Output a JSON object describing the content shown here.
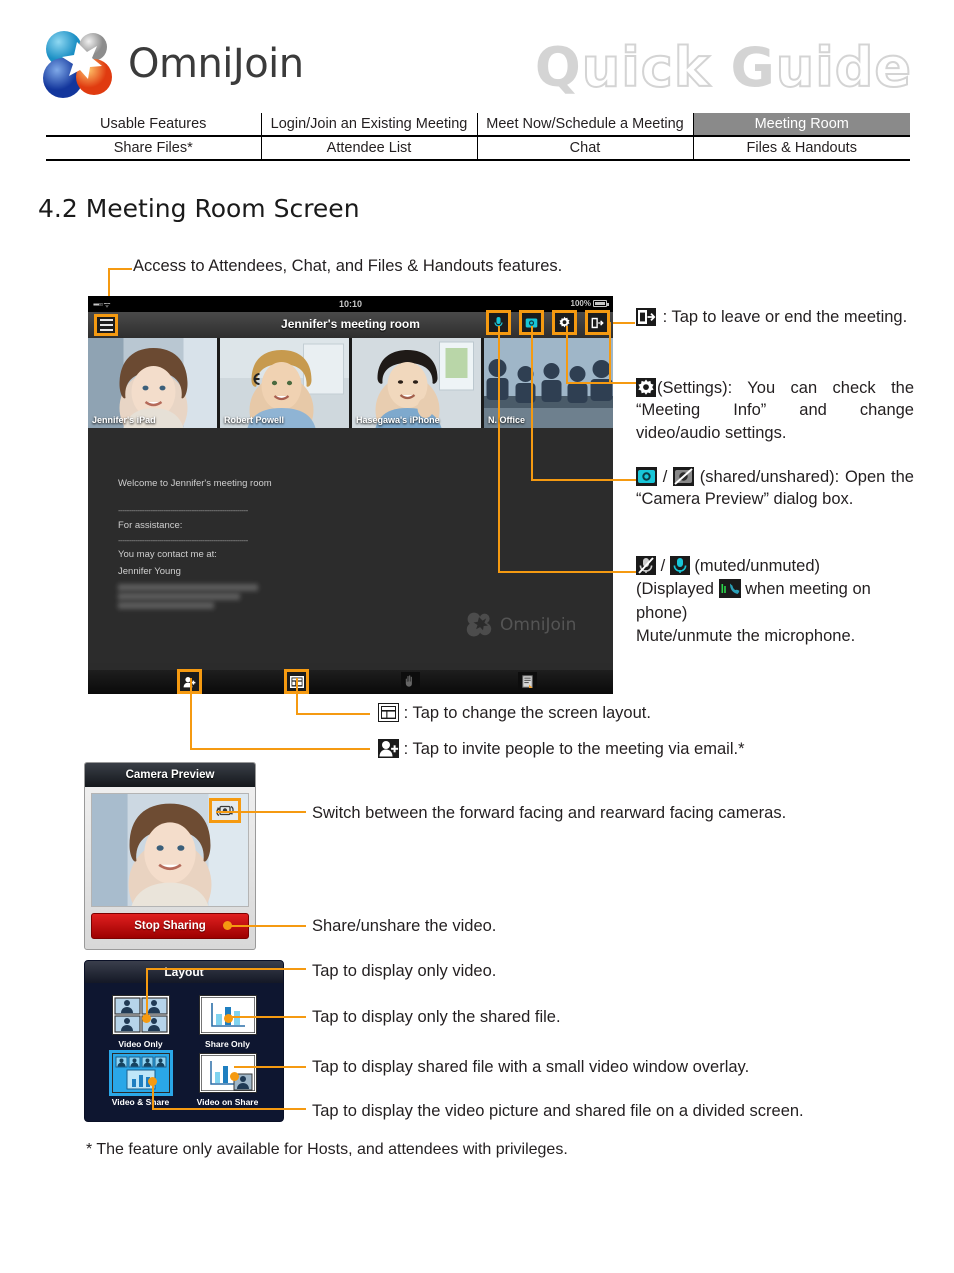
{
  "header": {
    "brand": "OmniJoin",
    "guide_solid_1": "Q",
    "guide_outline_1": "uick",
    "guide_solid_2": "G",
    "guide_outline_2": "uide",
    "accent_color": "#f59a11",
    "active_nav_bg": "#8a8a8a"
  },
  "nav": {
    "row1": [
      "Usable Features",
      "Login/Join an Existing Meeting",
      "Meet Now/Schedule a Meeting",
      "Meeting Room"
    ],
    "row2": [
      "Share Files*",
      "Attendee List",
      "Chat",
      "Files & Handouts"
    ],
    "active": "Meeting Room"
  },
  "section": {
    "title": "4.2 Meeting Room Screen"
  },
  "callouts": {
    "menu": "Access to Attendees, Chat, and Files & Handouts features.",
    "leave_icon": "leave-meeting-icon",
    "leave": " : Tap to leave or end the meeting.",
    "settings_icon": "gear-icon",
    "settings": "(Settings): You can check the “Meeting Info” and change video/audio settings.",
    "camera_shared_icon": "camera-shared-icon",
    "camera_unshared_icon": "camera-unshared-icon",
    "camera_slash": " / ",
    "camera": " (shared/unshared): Open the “Camera Preview” dialog box.",
    "mic_muted_icon": "mic-muted-icon",
    "mic_unmuted_icon": "mic-unmuted-icon",
    "phone_icon": "phone-meeting-icon",
    "mic_line1_a": " / ",
    "mic_line1_b": " (muted/unmuted)",
    "mic_line2_a": "(Displayed ",
    "mic_line2_b": " when meeting on phone)",
    "mic_line3": "Mute/unmute the microphone.",
    "layout_icon": "layout-icon",
    "layout": " : Tap to change the screen layout.",
    "invite_icon": "invite-person-icon",
    "invite": " : Tap to invite people to the meeting via email.*",
    "switch_camera": "Switch between the forward facing and rearward facing cameras.",
    "share_video": "Share/unshare the video.",
    "video_only": "Tap to display only video.",
    "share_only": "Tap to display only the shared file.",
    "video_on_share": "Tap to display shared file with a small video window overlay.",
    "video_and_share": "Tap to display the video picture and shared file on a divided screen."
  },
  "tablet": {
    "status": {
      "time": "10:10",
      "battery": "100%",
      "signal": "signal-icon"
    },
    "title": "Jennifer's meeting room",
    "menu_icon": "hamburger-menu-icon",
    "toolbar_icons": [
      {
        "name": "mic-icon",
        "boxed": true
      },
      {
        "name": "camera-icon",
        "boxed": true
      },
      {
        "name": "settings-gear-icon",
        "boxed": true
      },
      {
        "name": "leave-meeting-icon",
        "boxed": true
      }
    ],
    "participants": [
      {
        "label": "Jennifer's iPad"
      },
      {
        "label": "Robert Powell"
      },
      {
        "label": "Hasegawa's iPhone"
      },
      {
        "label": "N. Office"
      }
    ],
    "message": {
      "line1": "Welcome to Jennifer's meeting room",
      "sep1": "------------------------------------------------------------",
      "line2": "For assistance:",
      "sep2": "------------------------------------------------------------",
      "line3": "You may contact me at:",
      "line4": "Jennifer Young"
    },
    "watermark": "OmniJoin",
    "bottom_icons": [
      {
        "name": "invite-person-icon",
        "boxed": true
      },
      {
        "name": "layout-icon",
        "boxed": true
      },
      {
        "name": "pointer-hand-icon",
        "boxed": false
      },
      {
        "name": "notes-icon",
        "boxed": false
      }
    ]
  },
  "camera_dialog": {
    "title": "Camera Preview",
    "switch_icon": "switch-camera-icon",
    "button_label": "Stop Sharing",
    "button_color": "#c71414"
  },
  "layout_dialog": {
    "title": "Layout",
    "options": [
      {
        "label": "Video Only",
        "icon": "video-only-icon",
        "selected": false
      },
      {
        "label": "Share Only",
        "icon": "share-only-icon",
        "selected": false
      },
      {
        "label": "Video & Share",
        "icon": "video-and-share-icon",
        "selected": true
      },
      {
        "label": "Video on Share",
        "icon": "video-on-share-icon",
        "selected": false
      }
    ]
  },
  "footnote": "* The feature only available for Hosts, and attendees with privileges."
}
